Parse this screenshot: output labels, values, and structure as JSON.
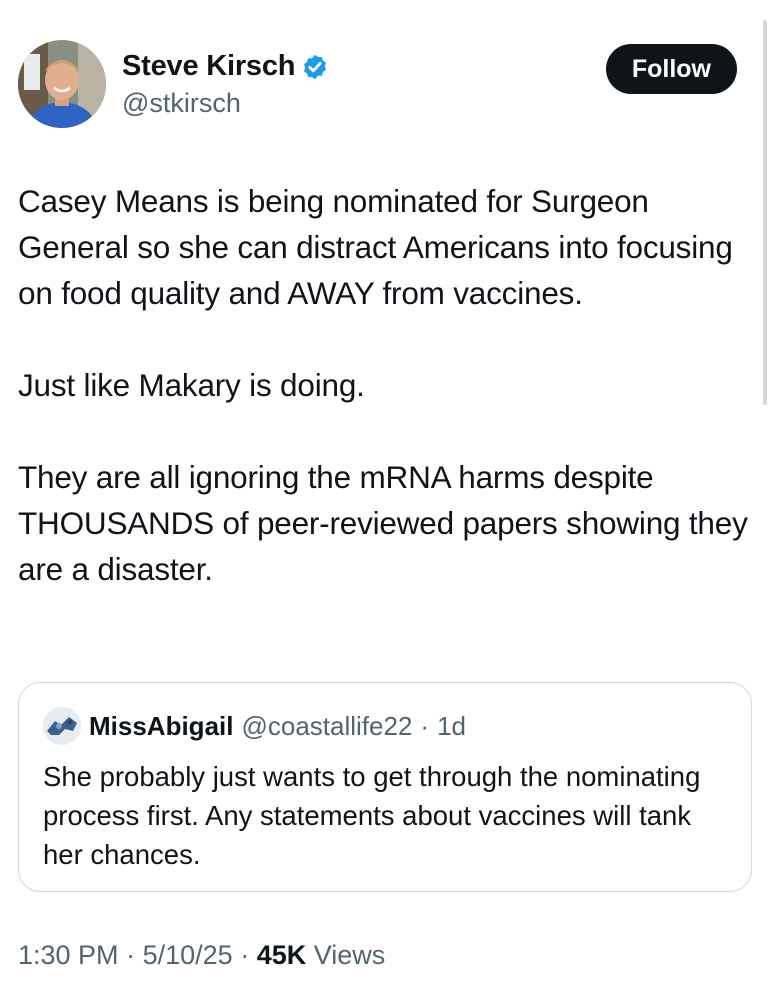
{
  "author": {
    "name": "Steve Kirsch",
    "handle": "@stkirsch",
    "verified_icon": "verified-badge-icon",
    "verified_color": "#1d9bf0"
  },
  "follow_button": {
    "label": "Follow"
  },
  "tweet": {
    "paragraphs": [
      "Casey Means is being nominated for Surgeon General so she can distract Americans into focusing on food quality and AWAY from vaccines.",
      "Just like Makary is doing.",
      "They are all ignoring the mRNA harms despite THOUSANDS of peer-reviewed papers showing they are a disaster."
    ]
  },
  "quote": {
    "name": "MissAbigail",
    "handle": "@coastallife22",
    "separator": "·",
    "time": "1d",
    "text": "She probably just wants to get through the nominating process first. Any statements about vaccines will tank her chances."
  },
  "meta": {
    "time": "1:30 PM",
    "separator": "·",
    "date": "5/10/25",
    "views_count": "45K",
    "views_label": "Views"
  },
  "colors": {
    "text": "#0f1419",
    "secondary": "#536471",
    "border": "#cfd9de",
    "button_bg": "#0f1419"
  }
}
